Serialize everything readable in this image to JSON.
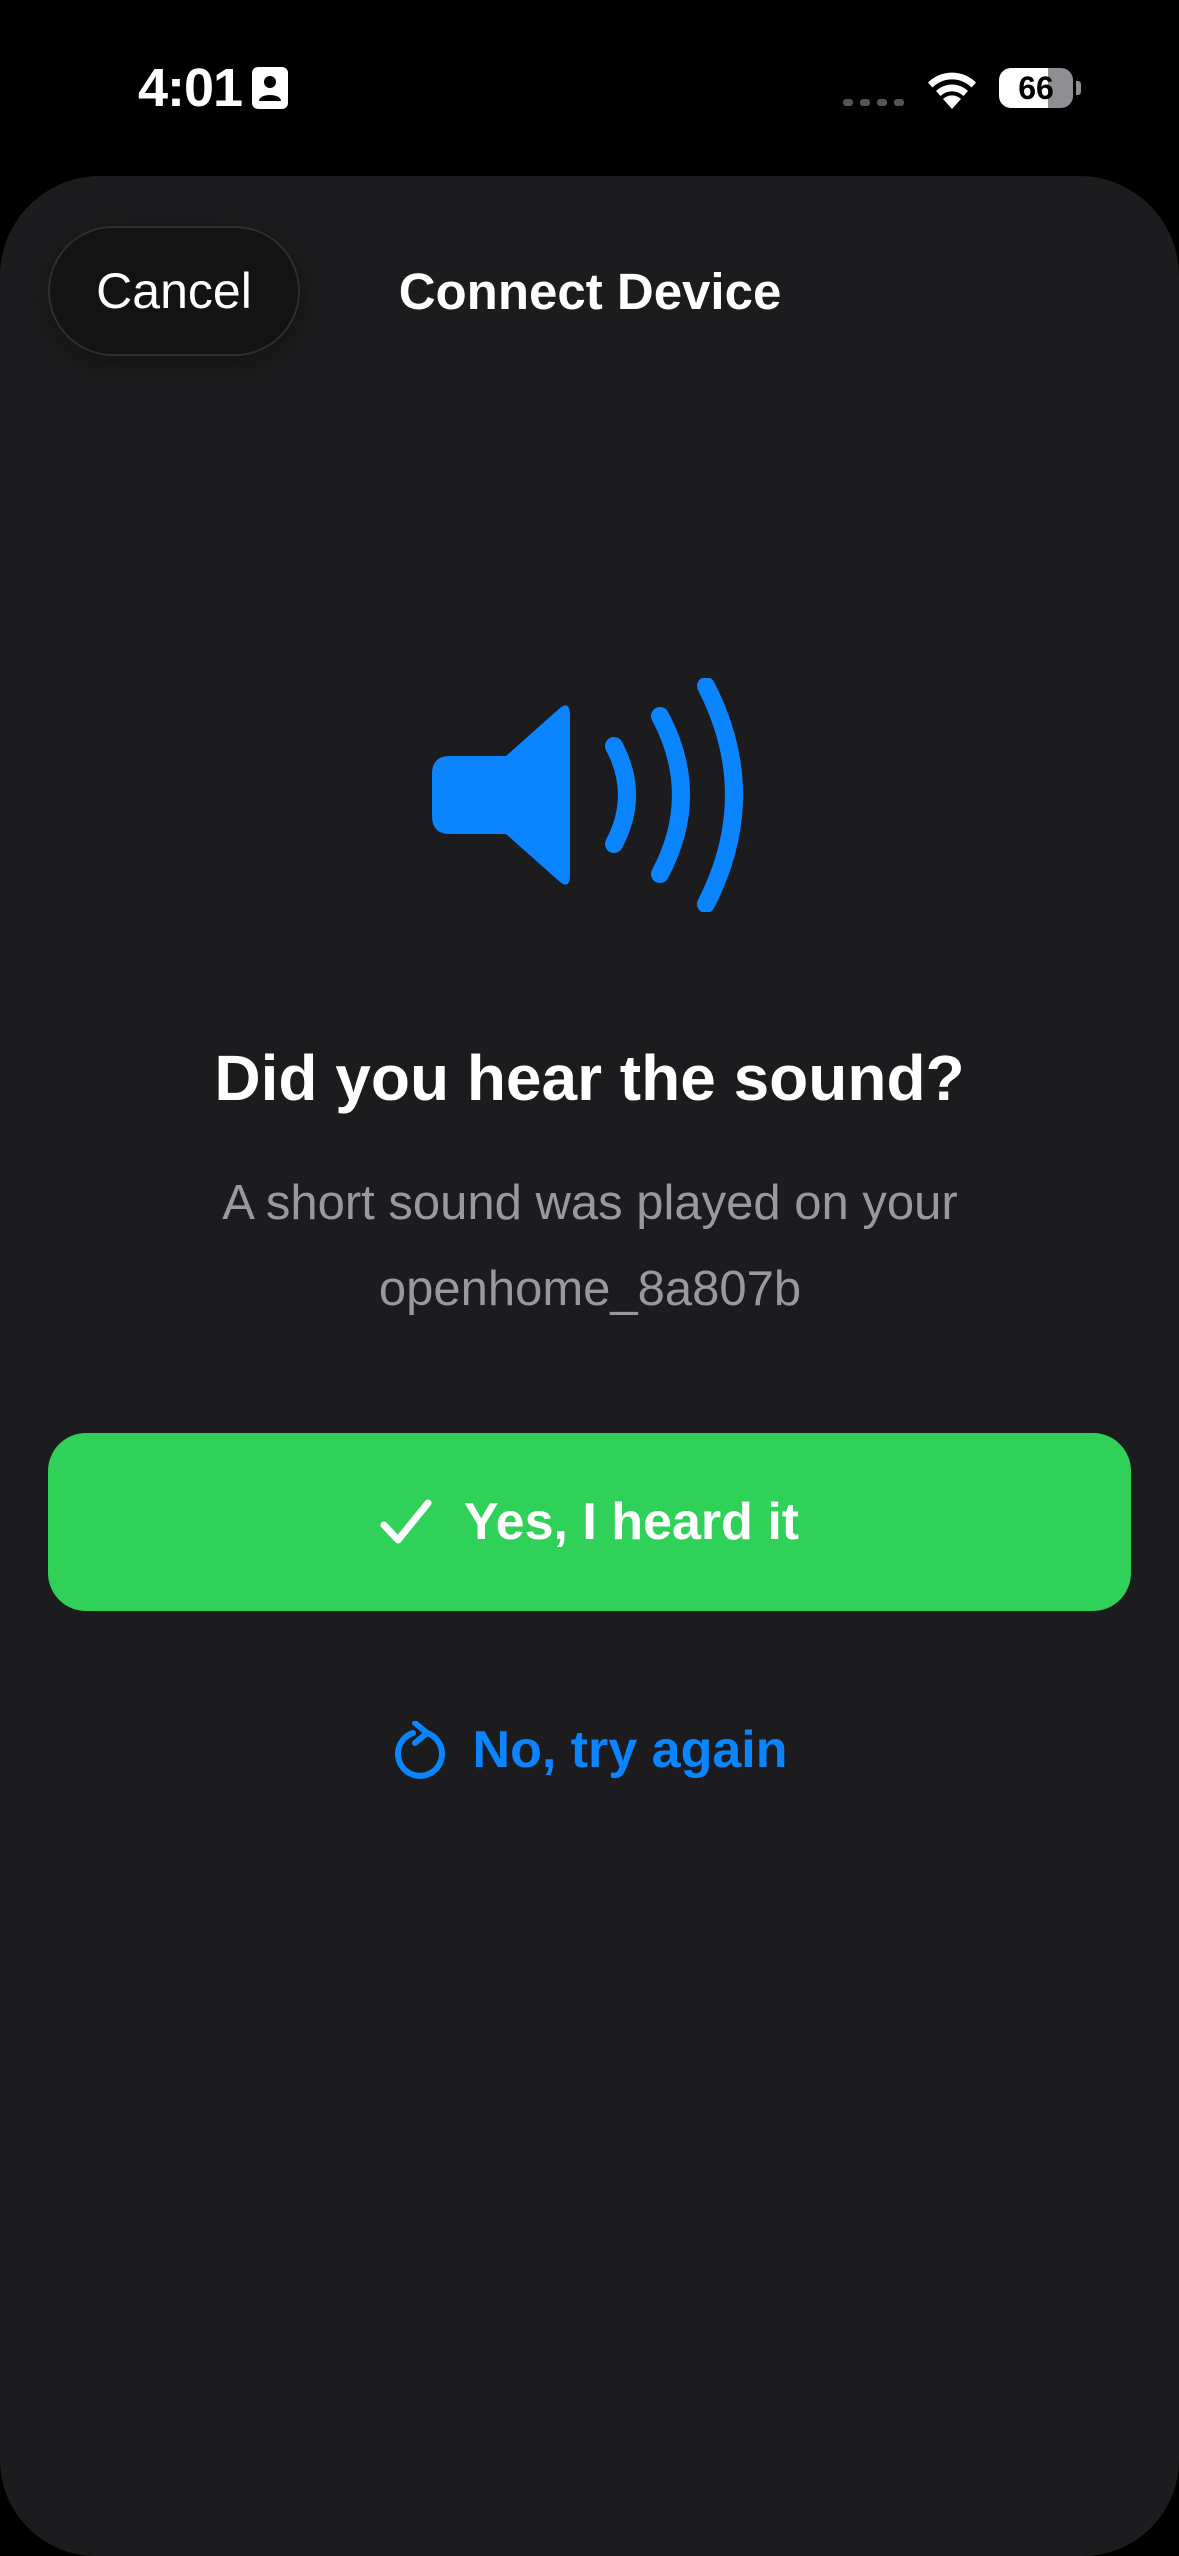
{
  "status_bar": {
    "time": "4:01",
    "battery_level": 66,
    "battery_label": "66",
    "icons": [
      "contact-card-icon",
      "cellular-signal-icon",
      "wifi-icon",
      "battery-icon"
    ]
  },
  "nav": {
    "cancel_label": "Cancel",
    "title": "Connect Device"
  },
  "content": {
    "icon": "speaker-wave-icon",
    "question": "Did you hear the sound?",
    "description_line1": "A short sound was played on your",
    "description_line2": "openhome_8a807b"
  },
  "actions": {
    "confirm_label": "Yes, I heard it",
    "confirm_icon": "checkmark-icon",
    "retry_label": "No, try again",
    "retry_icon": "retry-icon"
  },
  "colors": {
    "background": "#000000",
    "sheet": "#1c1c1e",
    "accent_blue": "#0a84ff",
    "success_green": "#30d158",
    "secondary_text": "#98989e"
  }
}
